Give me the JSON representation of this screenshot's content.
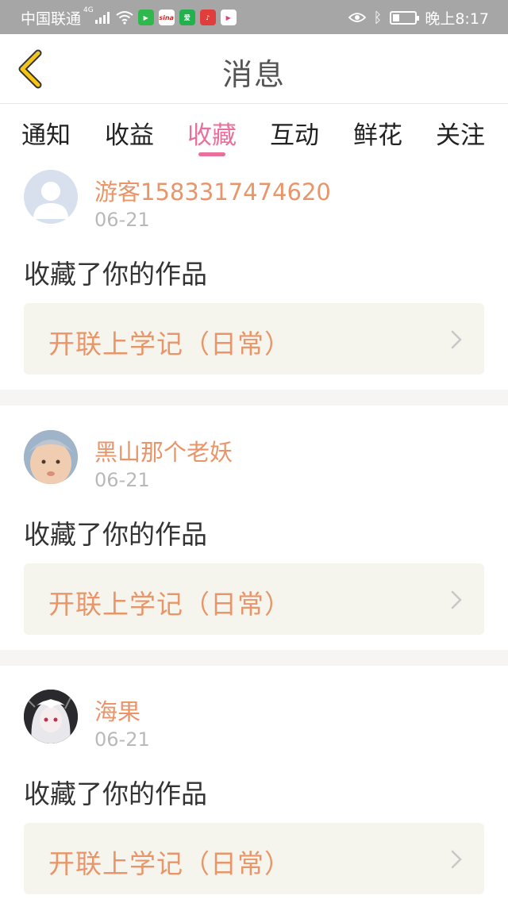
{
  "status_bar": {
    "carrier": "中国联通",
    "network": "4G",
    "time": "晚上8:17",
    "app_icons": [
      {
        "name": "video-app-icon",
        "color": "#2fb84c",
        "glyph": "▶"
      },
      {
        "name": "sina-app-icon",
        "color": "#ffffff",
        "glyph": "sina"
      },
      {
        "name": "iqiyi-app-icon",
        "color": "#22b14c",
        "glyph": "爱"
      },
      {
        "name": "music-app-icon",
        "color": "#e23d3d",
        "glyph": "♪"
      },
      {
        "name": "player-app-icon",
        "color": "#ffffff",
        "glyph": "▶"
      }
    ]
  },
  "header": {
    "title": "消息",
    "back_icon": "chevron-left-icon"
  },
  "tabs": [
    {
      "label": "通知",
      "active": false
    },
    {
      "label": "收益",
      "active": false
    },
    {
      "label": "收藏",
      "active": true
    },
    {
      "label": "互动",
      "active": false
    },
    {
      "label": "鲜花",
      "active": false
    },
    {
      "label": "关注",
      "active": false
    }
  ],
  "feed": [
    {
      "username": "游客1583317474620",
      "date": "06-21",
      "action": "收藏了你的作品",
      "work_title": "开联上学记（日常）",
      "avatar": "default-avatar-icon"
    },
    {
      "username": "黑山那个老妖",
      "date": "06-21",
      "action": "收藏了你的作品",
      "work_title": "开联上学记（日常）",
      "avatar": "baby-photo-avatar"
    },
    {
      "username": "海果",
      "date": "06-21",
      "action": "收藏了你的作品",
      "work_title": "开联上学记（日常）",
      "avatar": "anime-girl-avatar"
    }
  ],
  "colors": {
    "accent_pink": "#e8709b",
    "name_orange": "#e9956a",
    "card_bg": "#f5f5ee",
    "status_bar": "#a6a6a6"
  }
}
